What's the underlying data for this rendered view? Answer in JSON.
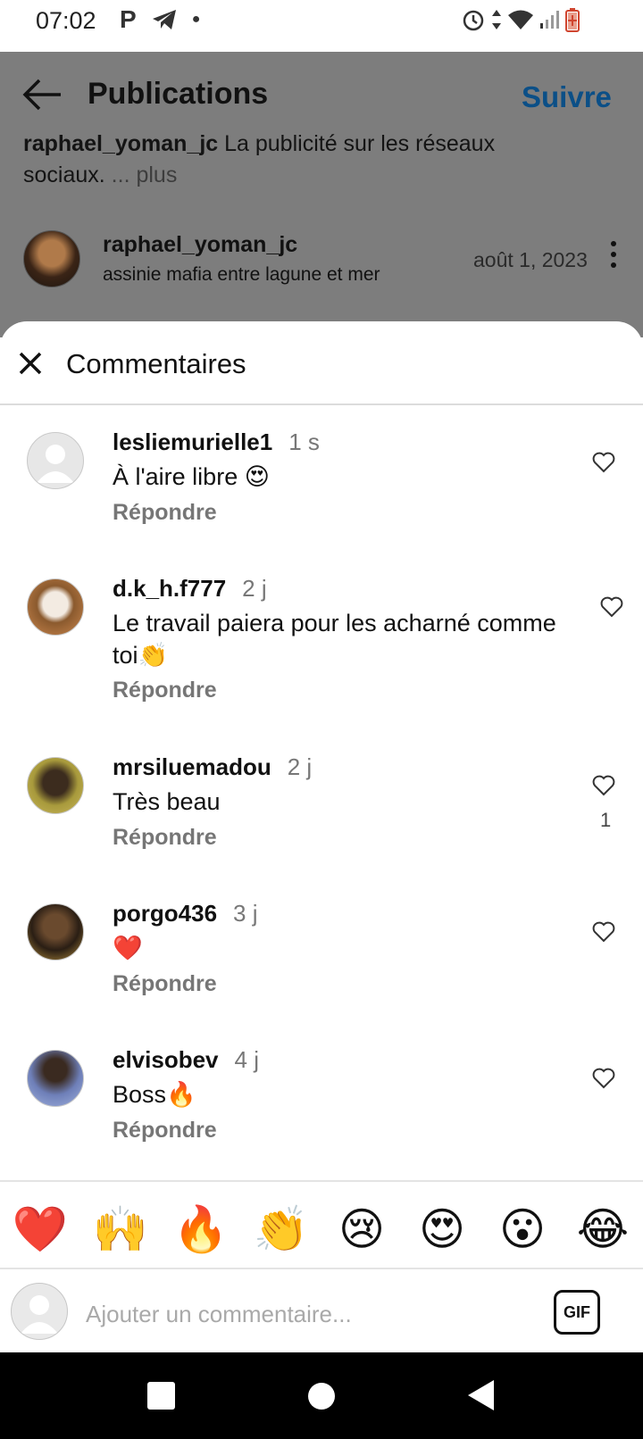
{
  "status_bar": {
    "time": "07:02",
    "p_icon": "P"
  },
  "header": {
    "title": "Publications",
    "follow_label": "Suivre"
  },
  "post": {
    "caption_user": "raphael_yoman_jc",
    "caption_text": "La publicité sur les réseaux sociaux.",
    "caption_more": "... plus",
    "username": "raphael_yoman_jc",
    "location": "assinie mafia entre lagune et mer",
    "date": "août 1, 2023"
  },
  "sheet": {
    "title": "Commentaires"
  },
  "comments": [
    {
      "user": "lesliemurielle1",
      "time": "1 s",
      "text": "À l'aire libre 😍",
      "reply": "Répondre",
      "likes": ""
    },
    {
      "user": "d.k_h.f777",
      "time": "2 j",
      "text": "Le travail paiera pour les acharné comme toi👏",
      "reply": "Répondre",
      "likes": ""
    },
    {
      "user": "mrsiluemadou",
      "time": "2 j",
      "text": "Très beau",
      "reply": "Répondre",
      "likes": "1"
    },
    {
      "user": "porgo436",
      "time": "3 j",
      "text": "❤️",
      "reply": "Répondre",
      "likes": ""
    },
    {
      "user": "elvisobev",
      "time": "4 j",
      "text": "Boss🔥",
      "reply": "Répondre",
      "likes": ""
    }
  ],
  "emoji_bar": [
    "❤️",
    "🙌",
    "🔥",
    "👏",
    "😢",
    "😍",
    "😮",
    "😂"
  ],
  "comment_input": {
    "placeholder": "Ajouter un commentaire...",
    "gif_label": "GIF"
  },
  "colors": {
    "follow_blue": "#0b4f87",
    "heart_red": "#e0212e"
  }
}
